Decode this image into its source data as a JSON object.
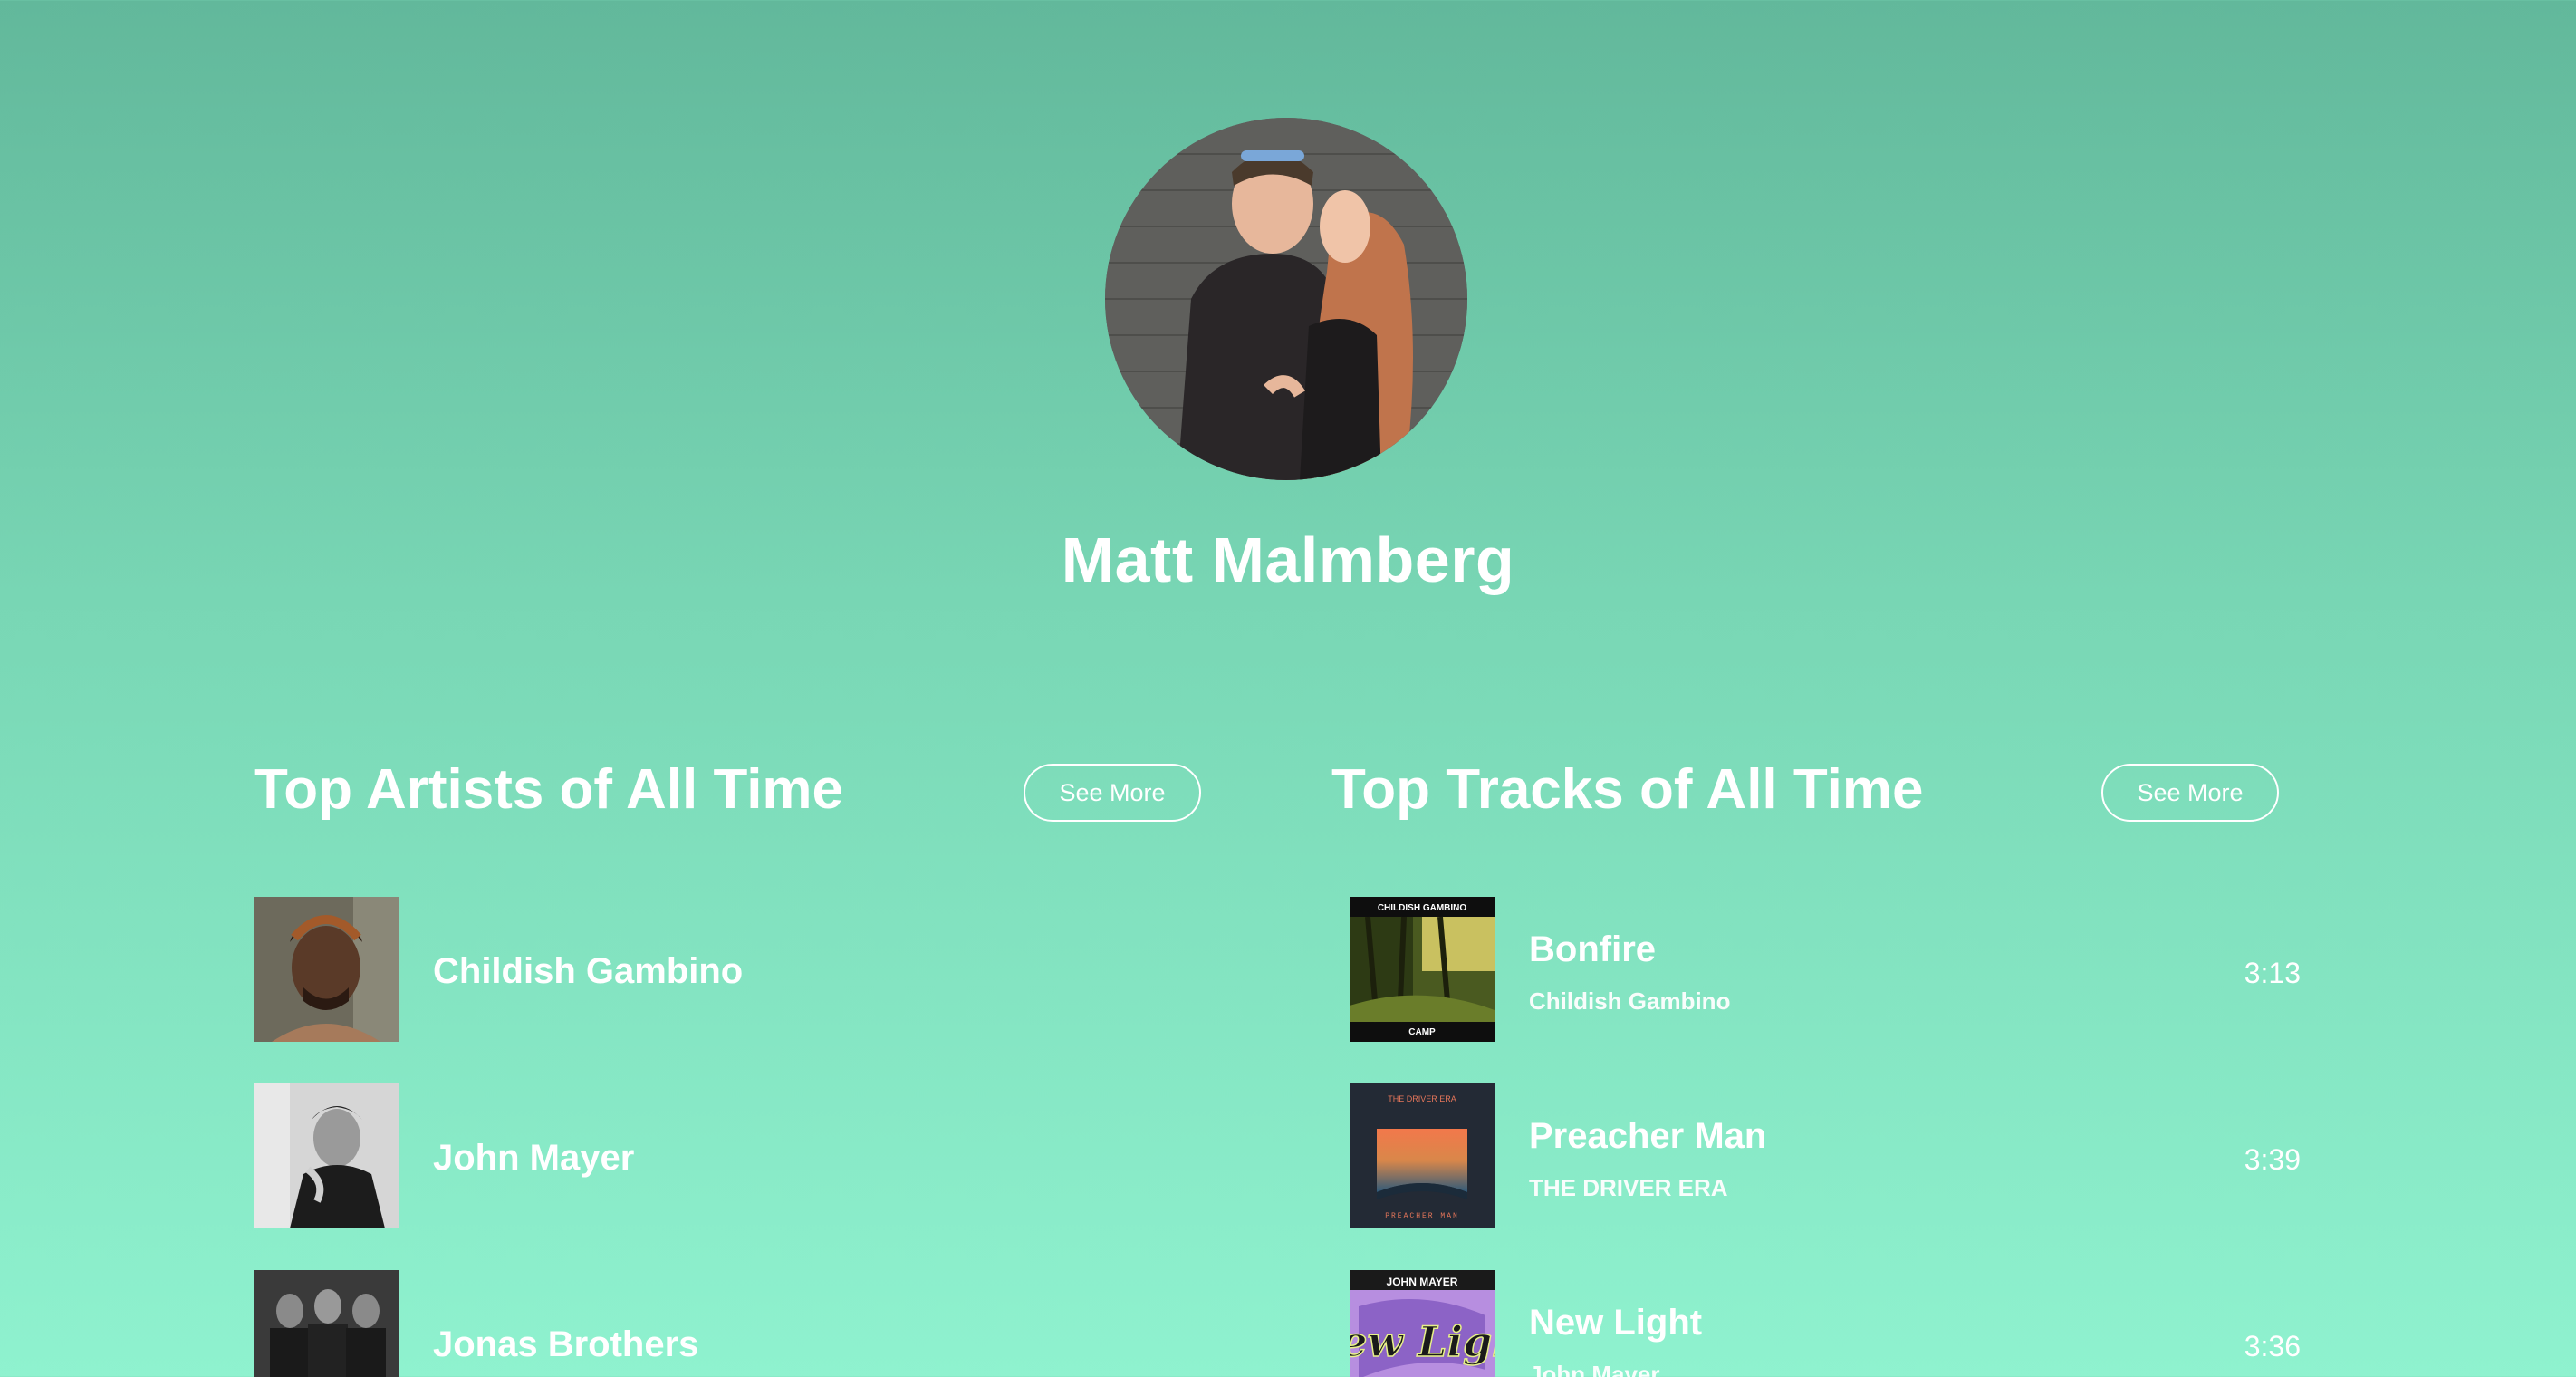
{
  "profile": {
    "name": "Matt Malmberg"
  },
  "top_artists": {
    "title": "Top Artists of All Time",
    "see_more_label": "See More",
    "items": [
      {
        "name": "Childish Gambino"
      },
      {
        "name": "John Mayer"
      },
      {
        "name": "Jonas Brothers"
      }
    ]
  },
  "top_tracks": {
    "title": "Top Tracks of All Time",
    "see_more_label": "See More",
    "items": [
      {
        "title": "Bonfire",
        "artist": "Childish Gambino",
        "duration": "3:13",
        "cover_text_top": "CHILDISH GAMBINO",
        "cover_text_bottom": "CAMP"
      },
      {
        "title": "Preacher Man",
        "artist": "THE DRIVER ERA",
        "duration": "3:39",
        "cover_text_top": "THE DRIVER ERA",
        "cover_text_bottom": "PREACHER MAN"
      },
      {
        "title": "New Light",
        "artist": "John Mayer",
        "duration": "3:36",
        "cover_text_top": "JOHN MAYER",
        "cover_text_bottom": "New Light"
      }
    ]
  },
  "colors": {
    "background_top": "#62b89b",
    "background_bottom": "#8ff2cf",
    "text": "#ffffff"
  }
}
